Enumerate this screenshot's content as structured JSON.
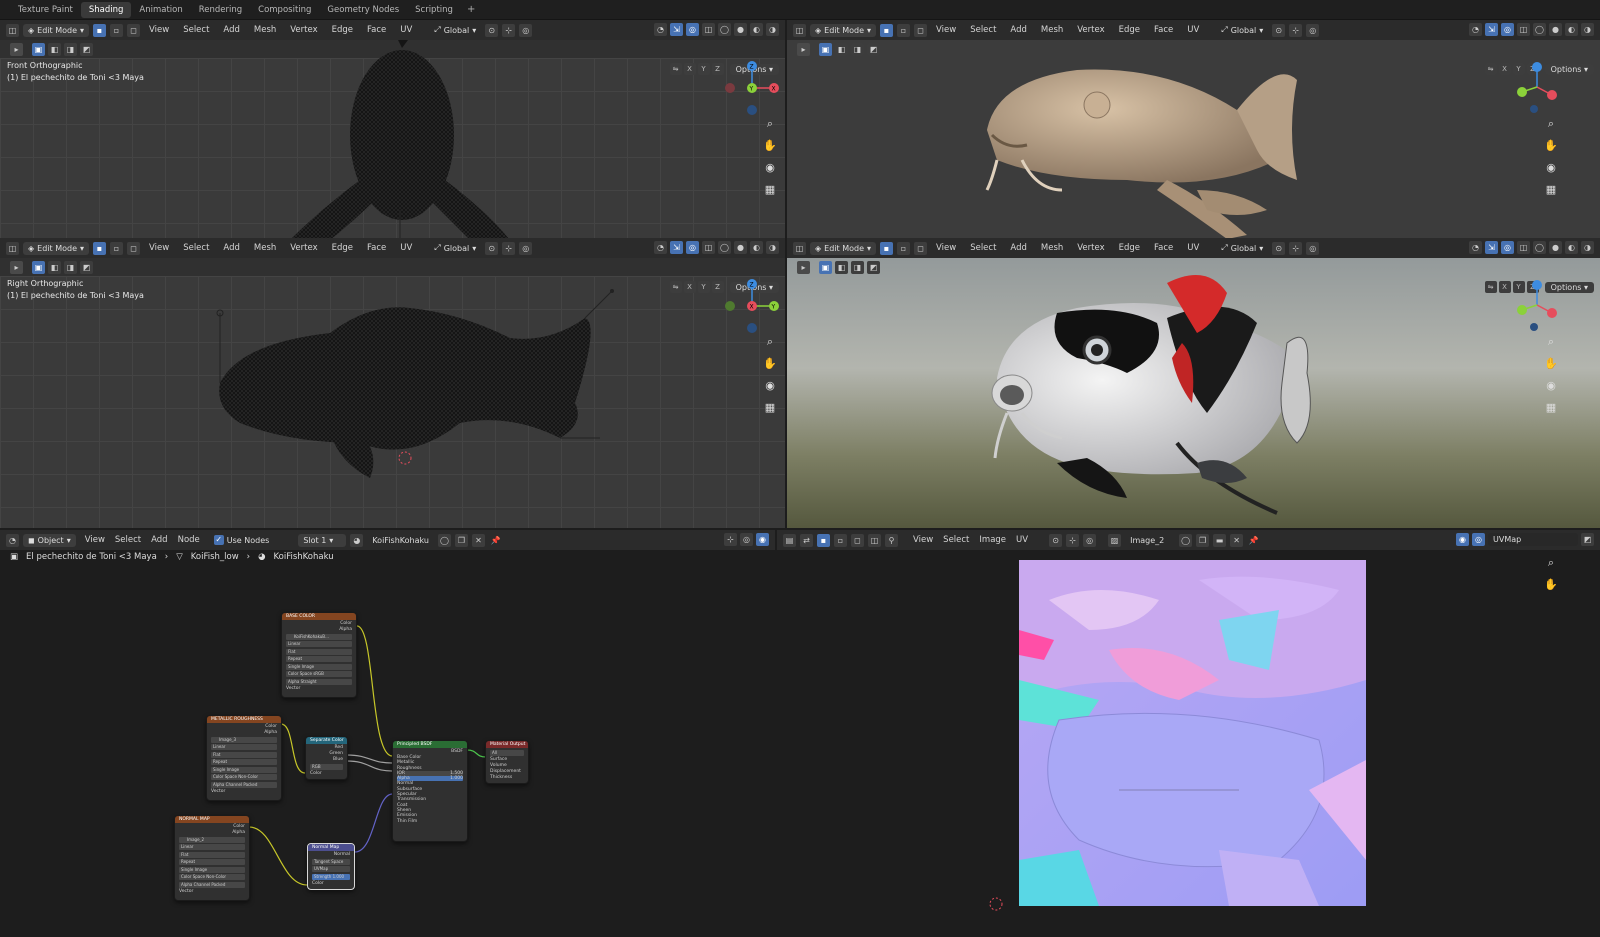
{
  "workspace_tabs": [
    "Texture Paint",
    "Shading",
    "Animation",
    "Rendering",
    "Compositing",
    "Geometry Nodes",
    "Scripting"
  ],
  "workspace_add": "+",
  "viewport_header": {
    "mode": "Edit Mode",
    "menus": [
      "View",
      "Select",
      "Add",
      "Mesh",
      "Vertex",
      "Edge",
      "Face",
      "UV"
    ],
    "orientation": "Global",
    "options": "Options",
    "axes": [
      "X",
      "Y",
      "Z"
    ]
  },
  "viewports": {
    "top_left": {
      "view_name": "Front Orthographic",
      "object_name": "(1) El pechechito de Toni <3 Maya"
    },
    "mid_left": {
      "view_name": "Right Orthographic",
      "object_name": "(1) El pechechito de Toni <3 Maya"
    }
  },
  "gizmo_labels": {
    "x": "X",
    "y": "Y",
    "z": "Z"
  },
  "node_editor": {
    "object_mode": "Object",
    "menus": [
      "View",
      "Select",
      "Add",
      "Node"
    ],
    "use_nodes_label": "Use Nodes",
    "use_nodes_checked": true,
    "slot": "Slot 1",
    "material": "KoiFishKohaku",
    "breadcrumb": [
      "El pechechito de Toni <3 Maya",
      "KoiFish_low",
      "KoiFishKohaku"
    ]
  },
  "image_editor": {
    "menus": [
      "View",
      "Select",
      "Image",
      "UV"
    ],
    "image_name": "Image_2",
    "uv_map": "UVMap"
  },
  "nodes": {
    "base_color": {
      "title": "BASE COLOR",
      "outputs": [
        "Color",
        "Alpha"
      ],
      "image": "KoiFishKohakuB...",
      "rows": [
        "Linear",
        "Flat",
        "Repeat",
        "Single Image"
      ],
      "color_space_label": "Color Space",
      "color_space": "sRGB",
      "alpha_label": "Alpha",
      "alpha": "Straight",
      "input": "Vector"
    },
    "metallic": {
      "title": "METALLIC ROUGHNESS",
      "outputs": [
        "Color",
        "Alpha"
      ],
      "image": "Image_3",
      "rows": [
        "Linear",
        "Flat",
        "Repeat",
        "Single Image"
      ],
      "color_space_label": "Color Space",
      "color_space": "Non-Color",
      "alpha_label": "Alpha",
      "alpha": "Channel Packed",
      "input": "Vector"
    },
    "normal": {
      "title": "NORMAL MAP",
      "outputs": [
        "Color",
        "Alpha"
      ],
      "image": "Image_2",
      "rows": [
        "Linear",
        "Flat",
        "Repeat",
        "Single Image"
      ],
      "color_space_label": "Color Space",
      "color_space": "Non-Color",
      "alpha_label": "Alpha",
      "alpha": "Channel Packed",
      "input": "Vector"
    },
    "separate": {
      "title": "Separate Color",
      "outputs": [
        "Red",
        "Green",
        "Blue"
      ],
      "mode": "RGB",
      "input": "Color"
    },
    "bsdf": {
      "title": "Principled BSDF",
      "output": "BSDF",
      "inputs": [
        "Base Color",
        "Metallic",
        "Roughness",
        "IOR",
        "Alpha",
        "Normal",
        "Subsurface",
        "Specular",
        "Transmission",
        "Coat",
        "Sheen",
        "Emission",
        "Thin Film"
      ],
      "ior_value": "1.500",
      "alpha_value": "1.000"
    },
    "output": {
      "title": "Material Output",
      "target": "All",
      "inputs": [
        "Surface",
        "Volume",
        "Displacement",
        "Thickness"
      ]
    },
    "normal_map": {
      "title": "Normal Map",
      "output": "Normal",
      "space": "Tangent Space",
      "uv": "UVMap",
      "strength_label": "Strength",
      "strength": "1.000",
      "input": "Color"
    }
  },
  "colors": {
    "accent": "#4772b3",
    "axis_x": "#e64d5c",
    "axis_y": "#8bd13a",
    "axis_z": "#3d8ce0",
    "node_image": "#844520",
    "node_vector": "#4c4e8f",
    "node_converter": "#24667b",
    "node_shader": "#2a6d34",
    "node_output": "#7a2a2a"
  }
}
